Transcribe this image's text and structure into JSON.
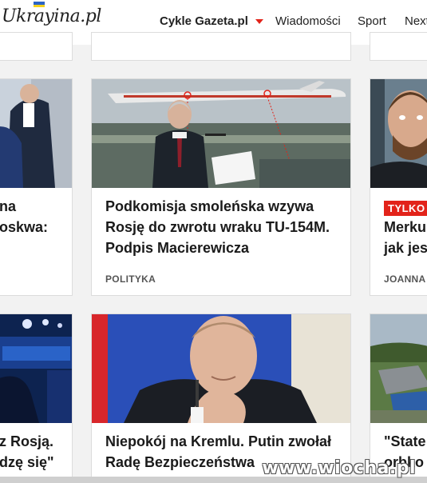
{
  "site": {
    "logo": "Ukrayina.pl"
  },
  "nav": [
    {
      "label": "Cykle Gazeta.pl"
    },
    {
      "label": "Wiadomości"
    },
    {
      "label": "Sport"
    },
    {
      "label": "Next"
    }
  ],
  "cards": {
    "left_top": {
      "headline_lines": [
        "na",
        "oskwa:"
      ]
    },
    "center_top": {
      "headline_lines": [
        "Podkomisja smoleńska wzywa",
        "Rosję do zwrotu wraku TU-154M.",
        "Podpis Macierewicza"
      ],
      "category": "POLITYKA"
    },
    "right_top": {
      "badge": "TYLKO",
      "headline_lines": [
        "Merku",
        "jak jes"
      ],
      "author": "JOANNA"
    },
    "left_bottom": {
      "headline_lines": [
        "z Rosją.",
        "dzę się\""
      ]
    },
    "center_bottom": {
      "headline_lines": [
        "Niepokój na Kremlu. Putin zwołał",
        "Radę Bezpieczeństwa"
      ]
    },
    "right_bottom": {
      "headline_lines": [
        "\"State",
        "orbko"
      ]
    }
  },
  "watermark": "www.wiocha.pl",
  "colors": {
    "accent": "#e2231a",
    "background": "#f2f2f2"
  }
}
